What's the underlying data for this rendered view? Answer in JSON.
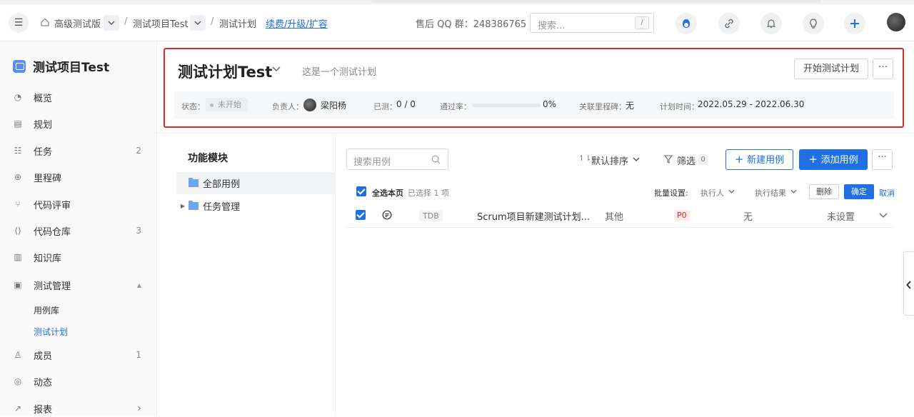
{
  "header": {
    "breadcrumb": [
      "高级测试版",
      "测试项目Test",
      "测试计划"
    ],
    "upgrade_link": "续费/升级/扩容",
    "qq_group": "售后 QQ 群：248386765",
    "search_placeholder": "搜索...",
    "search_shortcut": "/"
  },
  "sidebar": {
    "project_name": "测试项目Test",
    "items": [
      {
        "label": "概览",
        "icon": "dashboard-icon",
        "count": ""
      },
      {
        "label": "规划",
        "icon": "calendar-icon",
        "count": ""
      },
      {
        "label": "任务",
        "icon": "task-icon",
        "count": "2"
      },
      {
        "label": "里程碑",
        "icon": "milestone-icon",
        "count": ""
      },
      {
        "label": "代码评审",
        "icon": "merge-icon",
        "count": ""
      },
      {
        "label": "代码仓库",
        "icon": "code-icon",
        "count": "3"
      },
      {
        "label": "知识库",
        "icon": "book-icon",
        "count": ""
      },
      {
        "label": "测试管理",
        "icon": "test-icon",
        "count": ""
      },
      {
        "label": "成员",
        "icon": "members-icon",
        "count": "1"
      },
      {
        "label": "动态",
        "icon": "activity-icon",
        "count": ""
      },
      {
        "label": "报表",
        "icon": "report-icon",
        "count": ""
      }
    ],
    "sub_items": [
      {
        "label": "用例库",
        "active": false
      },
      {
        "label": "测试计划",
        "active": true
      }
    ]
  },
  "plan": {
    "title": "测试计划Test",
    "description": "这是一个测试计划",
    "start_button": "开始测试计划",
    "more": "···",
    "status_label": "状态：",
    "status_value": "未开始",
    "owner_label": "负责人：",
    "owner_name": "梁阳杨",
    "tested_label": "已测：",
    "tested_value": "0 / 0",
    "pass_label": "通过率：",
    "pass_value": "0%",
    "pass_rate": 0,
    "milestone_label": "关联里程碑：",
    "milestone_value": "无",
    "time_label": "计划时间：",
    "time_value": "2022.05.29 - 2022.06.30"
  },
  "modules": {
    "title": "功能模块",
    "items": [
      "全部用例",
      "任务管理"
    ]
  },
  "cases": {
    "search_placeholder": "搜索用例",
    "sort_label": "默认排序",
    "filter_label": "筛选",
    "filter_count": "0",
    "new_button": "新建用例",
    "add_button": "添加用例",
    "select_all": "全选本页",
    "selected_info": "已选择 1 项",
    "batch_label": "批量设置:",
    "executor": "执行人",
    "result": "执行结果",
    "delete_button": "删除",
    "confirm_button": "确定",
    "cancel_button": "取消",
    "rows": [
      {
        "type": "TDB",
        "title": "Scrum项目新建测试计划...",
        "module": "其他",
        "priority": "P0",
        "executor": "无",
        "result": "未设置"
      }
    ]
  },
  "colors": {
    "accent": "#1f6fe5",
    "highlight_border": "#e0271f",
    "priority_red": "#e0271f"
  }
}
